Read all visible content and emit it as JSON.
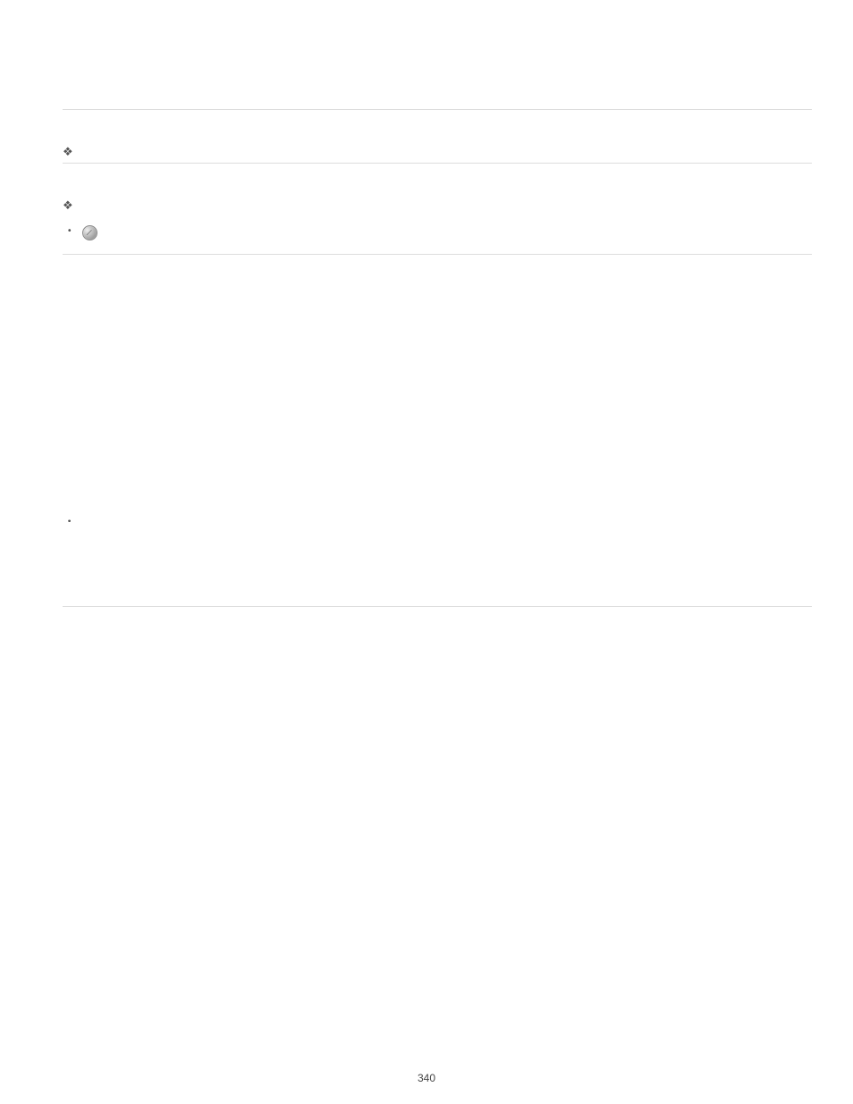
{
  "page_number": "340",
  "sections": [
    {
      "bullet_glyph": "❖",
      "text": ""
    },
    {
      "bullet_glyph": "❖",
      "text": "",
      "sub_items": [
        {
          "text": ""
        },
        {
          "text": "",
          "has_icon": true,
          "icon_name": "compass-icon"
        }
      ]
    }
  ],
  "mini_items": [
    {
      "text": ""
    },
    {
      "text": ""
    },
    {
      "text": ""
    },
    {
      "text": ""
    }
  ]
}
